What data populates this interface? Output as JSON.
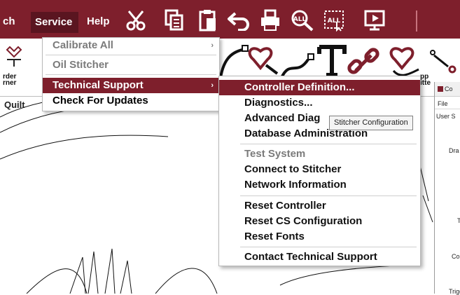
{
  "menubar": {
    "partial_label": "ch",
    "service_label": "Service",
    "help_label": "Help"
  },
  "toolbar_icons": [
    "scissors-icon",
    "copy-icon",
    "paste-icon",
    "undo-icon",
    "print-icon",
    "zoom-icon",
    "select-all-icon",
    "preview-icon"
  ],
  "select_all_label": "ALL",
  "toolbar2": {
    "left_labels": [
      "rder",
      "rner"
    ],
    "app_labels": [
      "pp",
      "itte"
    ]
  },
  "tab_label": "Quilt",
  "service_menu": [
    {
      "label": "Calibrate All",
      "state": "disabled",
      "has_submenu": true
    },
    {
      "label": "Oil Stitcher",
      "state": "disabled",
      "has_submenu": false
    },
    {
      "label": "Technical Support",
      "state": "active",
      "has_submenu": true
    },
    {
      "label": "Check For Updates",
      "state": "normal",
      "has_submenu": false
    }
  ],
  "submenu_chevron": "›",
  "technical_support_menu": [
    {
      "label": "Controller Definition...",
      "state": "active"
    },
    {
      "label": "Diagnostics...",
      "state": "normal"
    },
    {
      "label": "Advanced Diag",
      "state": "normal"
    },
    {
      "label": "Database Administration",
      "state": "normal"
    },
    {
      "label": "Test System",
      "state": "disabled"
    },
    {
      "label": "Connect to Stitcher",
      "state": "normal"
    },
    {
      "label": "Network Information",
      "state": "normal"
    },
    {
      "label": "Reset Controller",
      "state": "normal"
    },
    {
      "label": "Reset CS Configuration",
      "state": "normal"
    },
    {
      "label": "Reset Fonts",
      "state": "normal"
    },
    {
      "label": "Contact Technical Support",
      "state": "normal"
    }
  ],
  "tooltip": "Stitcher Configuration",
  "controller_window": {
    "title": "Co",
    "file_menu": "File",
    "labels": [
      "User S",
      "Dra",
      "T",
      "Co",
      "Trigg"
    ]
  },
  "colors": {
    "brand": "#7e1f2c",
    "service_active": "#5a1520",
    "icon_fill": "#ffffff",
    "toolbar2_icon": "#7e1f2c"
  }
}
